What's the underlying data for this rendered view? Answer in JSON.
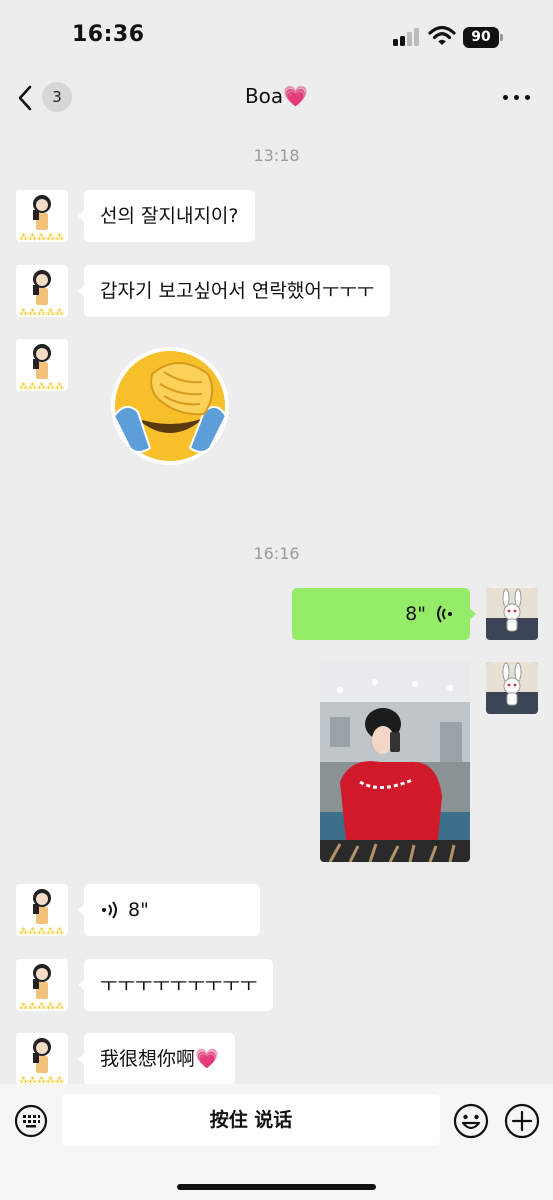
{
  "status_bar": {
    "time": "16:36",
    "battery": "90"
  },
  "nav": {
    "unread_count": "3",
    "title": "Boa",
    "title_heart": "💗"
  },
  "chat": {
    "timestamp_1": "13:18",
    "msg_1": "선의 잘지내지이?",
    "msg_2": "갑자기 보고싶어서 연락했어ㅜㅜㅜ",
    "timestamp_2": "16:16",
    "voice_out_duration": "8\"",
    "voice_in_duration": "8\"",
    "msg_5": "ㅜㅜㅜㅜㅜㅜㅜㅜㅜ",
    "msg_6": "我很想你啊",
    "msg_6_heart": "💗"
  },
  "input_bar": {
    "hold_to_talk": "按住 说话"
  },
  "icons": {
    "back": "chevron-left-icon",
    "more": "more-dots-icon",
    "voice": "voice-wave-icon",
    "keyboard": "keyboard-icon",
    "emoji": "smiley-icon",
    "plus": "plus-circle-icon"
  },
  "colors": {
    "background": "#ededed",
    "outgoing_bubble": "#95ec69",
    "incoming_bubble": "#ffffff",
    "badge": "#d7d7d7"
  }
}
